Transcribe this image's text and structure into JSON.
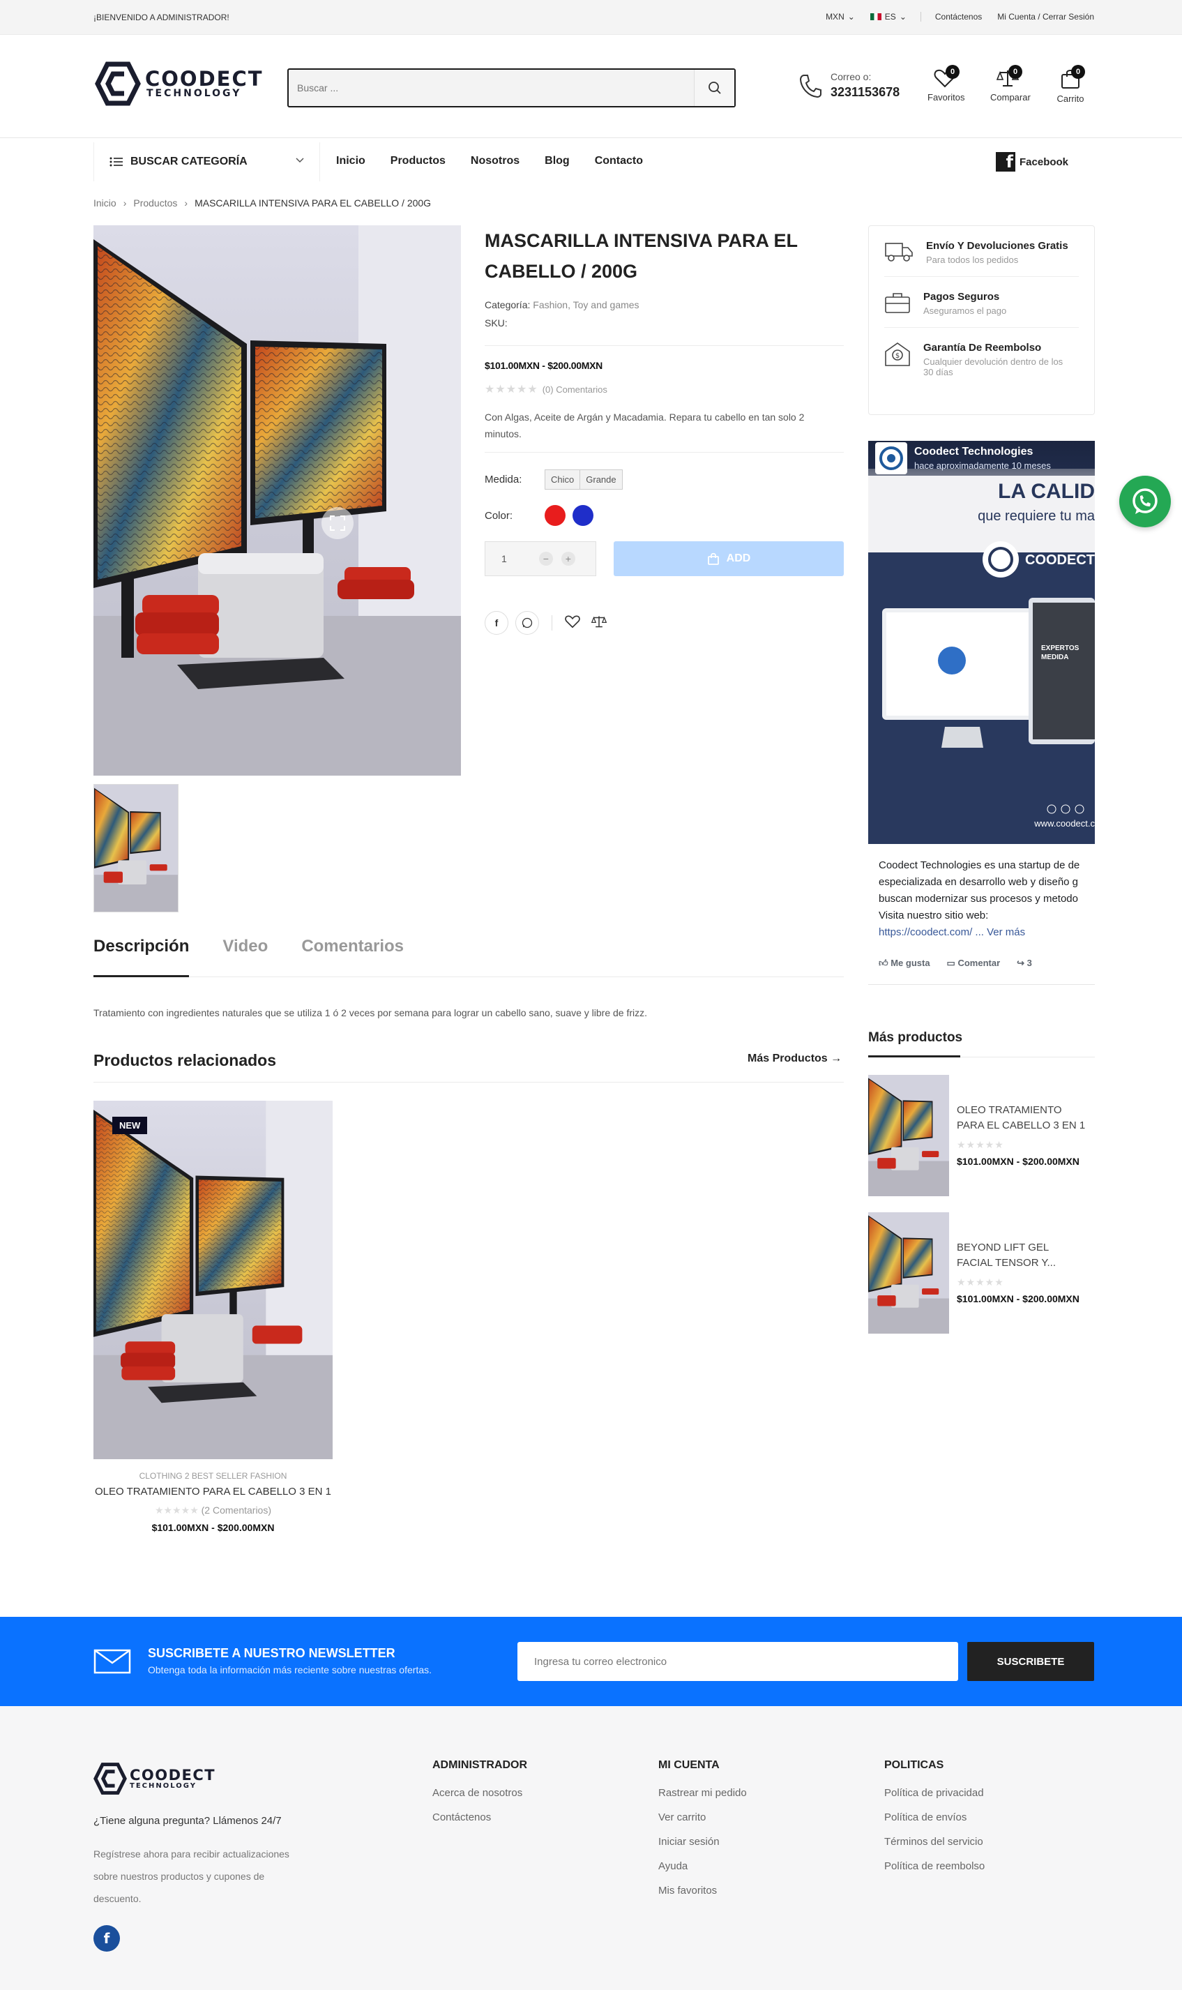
{
  "topbar": {
    "welcome": "¡BIENVENIDO A ADMINISTRADOR!",
    "currency": "MXN",
    "language": "ES",
    "contact_link": "Contáctenos",
    "account_link": "Mi Cuenta / Cerrar Sesión"
  },
  "header": {
    "logo_name": "COODECT",
    "logo_sub": "TECHNOLOGY",
    "search_placeholder": "Buscar ...",
    "contact_label": "Correo o:",
    "contact_phone": "3231153678",
    "favorites_label": "Favoritos",
    "favorites_count": "0",
    "compare_label": "Comparar",
    "compare_count": "0",
    "cart_label": "Carrito",
    "cart_count": "0"
  },
  "nav": {
    "category_button": "BUSCAR CATEGORÍA",
    "items": [
      "Inicio",
      "Productos",
      "Nosotros",
      "Blog",
      "Contacto"
    ],
    "facebook": "Facebook"
  },
  "breadcrumb": [
    "Inicio",
    "Productos",
    "MASCARILLA INTENSIVA PARA EL CABELLO / 200G"
  ],
  "product": {
    "title_line1": "MASCARILLA INTENSIVA PARA EL",
    "title_line2": "CABELLO / 200G",
    "category_label": "Categoría:",
    "category_1": "Fashion,",
    "category_2": "Toy and games",
    "sku_label": "SKU:",
    "price": "$101.00MXN - $200.00MXN",
    "rating": 0,
    "reviews": "(0) Comentarios",
    "description_1": "Con Algas, Aceite de Argán y Macadamia. Repara tu cabello en tan solo 2",
    "description_2": "minutos.",
    "size_label": "Medida:",
    "sizes": [
      "Chico",
      "Grande"
    ],
    "color_label": "Color:",
    "colors": [
      "#e81d1d",
      "#1f2ec9"
    ],
    "quantity": "1",
    "add_button": "ADD"
  },
  "benefits": [
    {
      "title": "Envío Y Devoluciones Gratis",
      "sub": "Para todos los pedidos",
      "icon": "truck-icon"
    },
    {
      "title": "Pagos Seguros",
      "sub": "Aseguramos el pago",
      "icon": "briefcase-icon"
    },
    {
      "title": "Garantía De Reembolso",
      "sub": "Cualquier devolución dentro de los 30 días",
      "icon": "money-envelope-icon"
    }
  ],
  "fb_widget": {
    "page_name": "Coodect Technologies",
    "time": "hace aproximadamente 10 meses",
    "ad_headline": "LA CALID",
    "ad_sub": "que requiere tu ma",
    "ad_brand": "COODECT TEC",
    "ad_url": "www.coodect.c",
    "text_1": "Coodect Technologies es una startup de de",
    "text_2": "especializada en desarrollo web y diseño g",
    "text_3": "buscan modernizar sus procesos y metodo",
    "text_4": "Visita nuestro sitio web:",
    "link": "https://coodect.com/",
    "see_more": "... Ver más",
    "like": "Me gusta",
    "comment": "Comentar",
    "shares": "3"
  },
  "tabs": [
    "Descripción",
    "Video",
    "Comentarios"
  ],
  "description_text": "Tratamiento con ingredientes naturales que se utiliza 1 ó 2 veces por semana para lograr un cabello sano, suave y libre de frizz.",
  "related": {
    "heading": "Productos relacionados",
    "more": "Más Productos",
    "card": {
      "tag": "NEW",
      "categories": "CLOTHING 2 BEST SELLER FASHION",
      "name": "OLEO TRATAMIENTO PARA EL CABELLO 3 EN 1",
      "reviews": "(2 Comentarios)",
      "price": "$101.00MXN - $200.00MXN"
    }
  },
  "more_products": {
    "heading": "Más productos",
    "items": [
      {
        "line1": "OLEO TRATAMIENTO",
        "line2": "PARA EL CABELLO 3 EN 1",
        "price": "$101.00MXN - $200.00MXN"
      },
      {
        "line1": "BEYOND LIFT GEL",
        "line2": "FACIAL TENSOR Y...",
        "price": "$101.00MXN - $200.00MXN"
      }
    ]
  },
  "newsletter": {
    "title": "SUSCRIBETE A NUESTRO NEWSLETTER",
    "subtitle": "Obtenga toda la información más reciente sobre nuestras ofertas.",
    "placeholder": "Ingresa tu correo electronico",
    "button": "SUSCRIBETE"
  },
  "footer": {
    "question": "¿Tiene alguna pregunta? Llámenos 24/7",
    "blurb_1": "Regístrese ahora para recibir actualizaciones",
    "blurb_2": "sobre nuestros productos y cupones de",
    "blurb_3": "descuento.",
    "columns": [
      {
        "heading": "ADMINISTRADOR",
        "items": [
          "Acerca de nosotros",
          "Contáctenos"
        ]
      },
      {
        "heading": "MI CUENTA",
        "items": [
          "Rastrear mi pedido",
          "Ver carrito",
          "Iniciar sesión",
          "Ayuda",
          "Mis favoritos"
        ]
      },
      {
        "heading": "POLITICAS",
        "items": [
          "Política de privacidad",
          "Política de envíos",
          "Términos del servicio",
          "Política de reembolso"
        ]
      }
    ]
  },
  "colors": {
    "accent": "#0a72ff",
    "add_button": "#b8d8ff",
    "whatsapp": "#24a854",
    "navy": "#1a1d2e"
  }
}
